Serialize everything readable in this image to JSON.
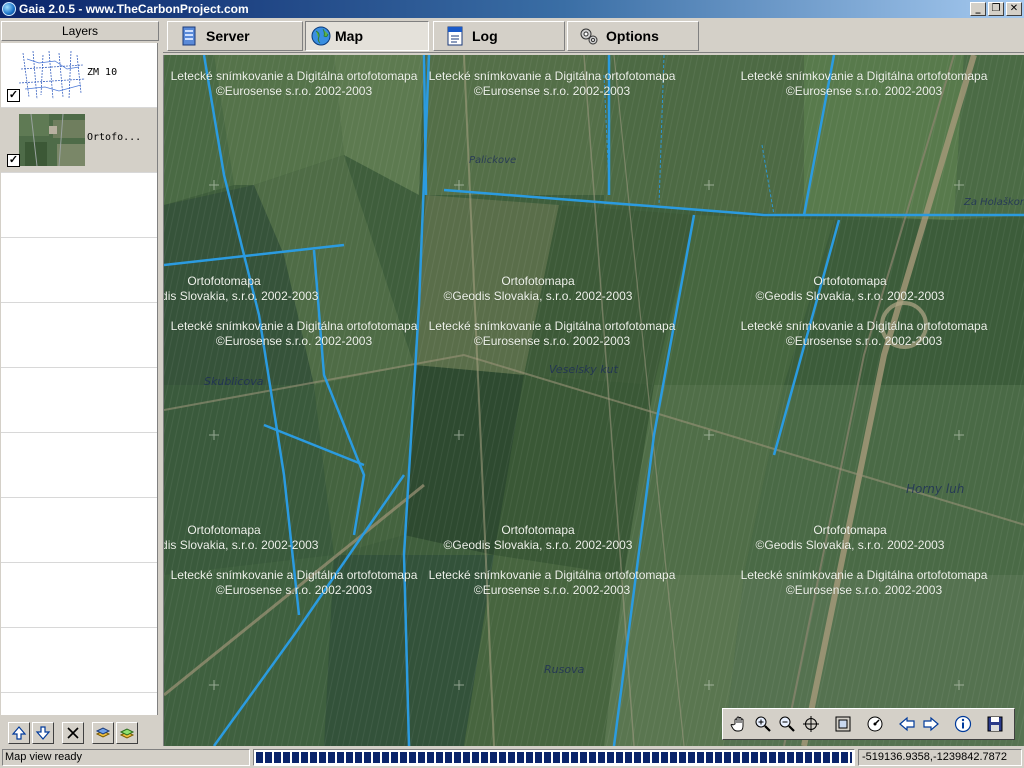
{
  "window": {
    "title": "Gaia 2.0.5 - www.TheCarbonProject.com",
    "minimize": "_",
    "maximize": "❐",
    "close": "✕"
  },
  "layers": {
    "header": "Layers",
    "items": [
      {
        "name": "ZM 10",
        "checked": true,
        "check": "✓"
      },
      {
        "name": "Ortofo...",
        "checked": true,
        "check": "✓"
      }
    ]
  },
  "tabs": [
    {
      "label": "Server",
      "icon": "server-icon",
      "active": false
    },
    {
      "label": "Map",
      "icon": "globe-icon",
      "active": true
    },
    {
      "label": "Log",
      "icon": "log-icon",
      "active": false
    },
    {
      "label": "Options",
      "icon": "options-icon",
      "active": false
    }
  ],
  "map": {
    "watermarks": {
      "geodis_line1": "Ortofotomapa",
      "geodis_line2": "©Geodis Slovakia, s.r.o. 2002-2003",
      "eurosense_line1": "Letecké snímkovanie a Digitálna ortofotomapa",
      "eurosense_line2": "©Eurosense s.r.o. 2002-2003"
    },
    "place_labels": [
      "Palickove",
      "Veselsky kut",
      "Skublicova",
      "Horny luh",
      "Za Holaškom",
      "Rusova"
    ]
  },
  "map_tools": [
    "pan-icon",
    "zoom-in-icon",
    "zoom-out-icon",
    "center-icon",
    "full-extent-icon",
    "refresh-icon",
    "back-icon",
    "forward-icon",
    "info-icon",
    "save-icon"
  ],
  "status": {
    "message": "Map view ready",
    "progress": 1.0,
    "coordinates": "-519136.9358,-1239842.7872"
  },
  "colors": {
    "titlebar": "#0a246a",
    "progress": "#0a246a",
    "map_lines": "#2b9be0"
  }
}
